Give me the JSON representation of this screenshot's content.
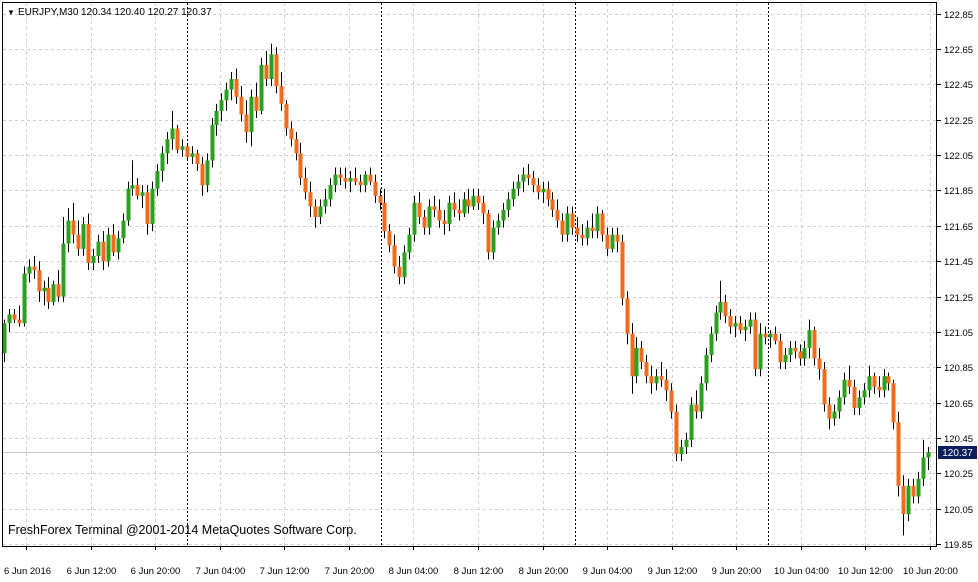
{
  "header": {
    "symbol": "EURJPY,M30",
    "ohlc": "120.34 120.40 120.27 120.37",
    "arrow": "▼"
  },
  "watermark": "FreshForex Terminal @2001-2014 MetaQuotes Software Corp.",
  "current_price_label": "120.37",
  "colors": {
    "bull": "#2aa01e",
    "bear": "#f26b1d",
    "wick": "#000000",
    "grid": "#cfcfcf",
    "separator": "#000000",
    "price_tag_bg": "#0b1f5c",
    "price_tag_fg": "#ffffff"
  },
  "chart_data": {
    "type": "candlestick",
    "timeframe": "M30",
    "grid": true,
    "y_ticks": [
      "122.85",
      "122.65",
      "122.45",
      "122.25",
      "122.05",
      "121.85",
      "121.65",
      "121.45",
      "121.25",
      "121.05",
      "120.85",
      "120.65",
      "120.45",
      "120.25",
      "120.05",
      "119.85"
    ],
    "x_ticks": [
      "6 Jun 2016",
      "6 Jun 12:00",
      "6 Jun 20:00",
      "7 Jun 04:00",
      "7 Jun 12:00",
      "7 Jun 20:00",
      "8 Jun 04:00",
      "8 Jun 12:00",
      "8 Jun 20:00",
      "9 Jun 04:00",
      "9 Jun 12:00",
      "9 Jun 20:00",
      "10 Jun 04:00",
      "10 Jun 12:00",
      "10 Jun 20:00"
    ],
    "day_separators_after": [
      "6 Jun 20:00",
      "7 Jun 20:00",
      "8 Jun 20:00",
      "9 Jun 20:00"
    ],
    "y_range": [
      119.84,
      122.91
    ],
    "last_close": 120.37,
    "ohlc": [
      [
        120.93,
        121.12,
        120.88,
        121.1
      ],
      [
        121.1,
        121.18,
        121.05,
        121.15
      ],
      [
        121.15,
        121.18,
        121.1,
        121.12
      ],
      [
        121.12,
        121.2,
        121.08,
        121.1
      ],
      [
        121.1,
        121.42,
        121.08,
        121.38
      ],
      [
        121.38,
        121.46,
        121.33,
        121.42
      ],
      [
        121.42,
        121.48,
        121.35,
        121.4
      ],
      [
        121.4,
        121.45,
        121.22,
        121.28
      ],
      [
        121.28,
        121.34,
        121.2,
        121.3
      ],
      [
        121.3,
        121.36,
        121.18,
        121.22
      ],
      [
        121.22,
        121.34,
        121.2,
        121.32
      ],
      [
        121.32,
        121.4,
        121.22,
        121.25
      ],
      [
        121.25,
        121.7,
        121.22,
        121.55
      ],
      [
        121.55,
        121.75,
        121.5,
        121.68
      ],
      [
        121.68,
        121.78,
        121.55,
        121.6
      ],
      [
        121.6,
        121.68,
        121.48,
        121.52
      ],
      [
        121.52,
        121.7,
        121.48,
        121.66
      ],
      [
        121.66,
        121.72,
        121.4,
        121.44
      ],
      [
        121.44,
        121.52,
        121.4,
        121.48
      ],
      [
        121.48,
        121.6,
        121.44,
        121.56
      ],
      [
        121.56,
        121.62,
        121.4,
        121.45
      ],
      [
        121.45,
        121.64,
        121.42,
        121.6
      ],
      [
        121.6,
        121.66,
        121.48,
        121.5
      ],
      [
        121.5,
        121.62,
        121.46,
        121.58
      ],
      [
        121.58,
        121.72,
        121.55,
        121.68
      ],
      [
        121.68,
        121.9,
        121.65,
        121.86
      ],
      [
        121.86,
        122.02,
        121.82,
        121.88
      ],
      [
        121.88,
        121.92,
        121.8,
        121.82
      ],
      [
        121.82,
        121.88,
        121.75,
        121.84
      ],
      [
        121.84,
        121.88,
        121.6,
        121.66
      ],
      [
        121.66,
        121.9,
        121.62,
        121.86
      ],
      [
        121.86,
        122.0,
        121.82,
        121.96
      ],
      [
        121.96,
        122.1,
        121.9,
        122.06
      ],
      [
        122.06,
        122.18,
        122.0,
        122.14
      ],
      [
        122.14,
        122.3,
        122.08,
        122.2
      ],
      [
        122.2,
        122.22,
        122.06,
        122.08
      ],
      [
        122.08,
        122.14,
        122.04,
        122.1
      ],
      [
        122.1,
        122.12,
        122.02,
        122.04
      ],
      [
        122.04,
        122.1,
        122.0,
        122.06
      ],
      [
        122.06,
        122.08,
        121.96,
        122.0
      ],
      [
        122.0,
        122.04,
        121.82,
        121.88
      ],
      [
        121.88,
        122.06,
        121.84,
        122.02
      ],
      [
        122.02,
        122.26,
        121.98,
        122.22
      ],
      [
        122.22,
        122.34,
        122.16,
        122.3
      ],
      [
        122.3,
        122.4,
        122.24,
        122.36
      ],
      [
        122.36,
        122.46,
        122.3,
        122.42
      ],
      [
        122.42,
        122.52,
        122.36,
        122.48
      ],
      [
        122.48,
        122.54,
        122.34,
        122.38
      ],
      [
        122.38,
        122.44,
        122.24,
        122.28
      ],
      [
        122.28,
        122.36,
        122.12,
        122.18
      ],
      [
        122.18,
        122.42,
        122.1,
        122.38
      ],
      [
        122.38,
        122.46,
        122.26,
        122.3
      ],
      [
        122.3,
        122.6,
        122.28,
        122.56
      ],
      [
        122.56,
        122.64,
        122.44,
        122.48
      ],
      [
        122.48,
        122.68,
        122.44,
        122.62
      ],
      [
        122.62,
        122.66,
        122.4,
        122.44
      ],
      [
        122.44,
        122.52,
        122.3,
        122.34
      ],
      [
        122.34,
        122.36,
        122.16,
        122.2
      ],
      [
        122.2,
        122.24,
        122.1,
        122.14
      ],
      [
        122.14,
        122.18,
        122.02,
        122.06
      ],
      [
        122.06,
        122.12,
        121.88,
        121.92
      ],
      [
        121.92,
        121.98,
        121.8,
        121.84
      ],
      [
        121.84,
        121.9,
        121.7,
        121.76
      ],
      [
        121.76,
        121.8,
        121.64,
        121.7
      ],
      [
        121.7,
        121.8,
        121.66,
        121.76
      ],
      [
        121.76,
        121.86,
        121.72,
        121.8
      ],
      [
        121.8,
        121.92,
        121.76,
        121.88
      ],
      [
        121.88,
        121.98,
        121.84,
        121.94
      ],
      [
        121.94,
        121.98,
        121.88,
        121.92
      ],
      [
        121.92,
        121.98,
        121.86,
        121.9
      ],
      [
        121.9,
        121.96,
        121.84,
        121.92
      ],
      [
        121.92,
        121.98,
        121.88,
        121.9
      ],
      [
        121.9,
        121.94,
        121.84,
        121.88
      ],
      [
        121.88,
        121.96,
        121.84,
        121.94
      ],
      [
        121.94,
        121.98,
        121.88,
        121.9
      ],
      [
        121.9,
        121.94,
        121.78,
        121.82
      ],
      [
        121.82,
        121.86,
        121.74,
        121.78
      ],
      [
        121.78,
        121.86,
        121.58,
        121.62
      ],
      [
        121.62,
        121.66,
        121.5,
        121.54
      ],
      [
        121.54,
        121.6,
        121.38,
        121.42
      ],
      [
        121.42,
        121.48,
        121.32,
        121.36
      ],
      [
        121.36,
        121.54,
        121.32,
        121.5
      ],
      [
        121.5,
        121.64,
        121.46,
        121.6
      ],
      [
        121.6,
        121.82,
        121.56,
        121.78
      ],
      [
        121.78,
        121.84,
        121.66,
        121.7
      ],
      [
        121.7,
        121.74,
        121.6,
        121.64
      ],
      [
        121.64,
        121.8,
        121.6,
        121.76
      ],
      [
        121.76,
        121.82,
        121.7,
        121.74
      ],
      [
        121.74,
        121.8,
        121.64,
        121.68
      ],
      [
        121.68,
        121.74,
        121.6,
        121.66
      ],
      [
        121.66,
        121.82,
        121.62,
        121.78
      ],
      [
        121.78,
        121.84,
        121.7,
        121.74
      ],
      [
        121.74,
        121.8,
        121.68,
        121.72
      ],
      [
        121.72,
        121.84,
        121.7,
        121.8
      ],
      [
        121.8,
        121.86,
        121.72,
        121.76
      ],
      [
        121.76,
        121.86,
        121.74,
        121.82
      ],
      [
        121.82,
        121.86,
        121.74,
        121.78
      ],
      [
        121.78,
        121.82,
        121.66,
        121.72
      ],
      [
        121.72,
        121.74,
        121.46,
        121.5
      ],
      [
        121.5,
        121.68,
        121.46,
        121.64
      ],
      [
        121.64,
        121.72,
        121.6,
        121.68
      ],
      [
        121.68,
        121.78,
        121.64,
        121.74
      ],
      [
        121.74,
        121.84,
        121.7,
        121.8
      ],
      [
        121.8,
        121.9,
        121.76,
        121.86
      ],
      [
        121.86,
        121.94,
        121.82,
        121.9
      ],
      [
        121.9,
        121.98,
        121.84,
        121.94
      ],
      [
        121.94,
        122.0,
        121.88,
        121.92
      ],
      [
        121.92,
        121.96,
        121.84,
        121.88
      ],
      [
        121.88,
        121.92,
        121.8,
        121.84
      ],
      [
        121.84,
        121.9,
        121.78,
        121.86
      ],
      [
        121.86,
        121.9,
        121.76,
        121.8
      ],
      [
        121.8,
        121.84,
        121.7,
        121.74
      ],
      [
        121.74,
        121.8,
        121.64,
        121.68
      ],
      [
        121.68,
        121.72,
        121.56,
        121.6
      ],
      [
        121.6,
        121.76,
        121.56,
        121.72
      ],
      [
        121.72,
        121.76,
        121.6,
        121.64
      ],
      [
        121.64,
        121.7,
        121.56,
        121.6
      ],
      [
        121.6,
        121.66,
        121.54,
        121.58
      ],
      [
        121.58,
        121.68,
        121.54,
        121.64
      ],
      [
        121.64,
        121.72,
        121.58,
        121.62
      ],
      [
        121.62,
        121.76,
        121.58,
        121.72
      ],
      [
        121.72,
        121.74,
        121.56,
        121.6
      ],
      [
        121.6,
        121.64,
        121.48,
        121.52
      ],
      [
        121.52,
        121.64,
        121.5,
        121.6
      ],
      [
        121.6,
        121.64,
        121.5,
        121.56
      ],
      [
        121.56,
        121.6,
        121.2,
        121.24
      ],
      [
        121.24,
        121.28,
        120.98,
        121.04
      ],
      [
        121.04,
        121.1,
        120.7,
        120.8
      ],
      [
        120.8,
        121.02,
        120.76,
        120.96
      ],
      [
        120.96,
        121.0,
        120.84,
        120.88
      ],
      [
        120.88,
        120.92,
        120.76,
        120.8
      ],
      [
        120.8,
        120.86,
        120.7,
        120.76
      ],
      [
        120.76,
        120.84,
        120.72,
        120.8
      ],
      [
        120.8,
        120.88,
        120.74,
        120.78
      ],
      [
        120.78,
        120.84,
        120.66,
        120.72
      ],
      [
        120.72,
        120.76,
        120.56,
        120.6
      ],
      [
        120.6,
        120.64,
        120.32,
        120.36
      ],
      [
        120.36,
        120.44,
        120.32,
        120.4
      ],
      [
        120.4,
        120.48,
        120.36,
        120.44
      ],
      [
        120.44,
        120.68,
        120.4,
        120.64
      ],
      [
        120.64,
        120.72,
        120.56,
        120.6
      ],
      [
        120.6,
        120.8,
        120.56,
        120.76
      ],
      [
        120.76,
        120.96,
        120.72,
        120.92
      ],
      [
        120.92,
        121.08,
        120.88,
        121.04
      ],
      [
        121.04,
        121.2,
        121.0,
        121.16
      ],
      [
        121.16,
        121.34,
        121.12,
        121.22
      ],
      [
        121.22,
        121.26,
        121.1,
        121.14
      ],
      [
        121.14,
        121.18,
        121.04,
        121.08
      ],
      [
        121.08,
        121.14,
        121.02,
        121.1
      ],
      [
        121.1,
        121.14,
        121.04,
        121.06
      ],
      [
        121.06,
        121.12,
        121.0,
        121.08
      ],
      [
        121.08,
        121.16,
        121.04,
        121.12
      ],
      [
        121.12,
        121.16,
        120.8,
        120.84
      ],
      [
        120.84,
        121.1,
        120.8,
        121.04
      ],
      [
        121.04,
        121.08,
        120.98,
        121.02
      ],
      [
        121.02,
        121.06,
        120.96,
        121.04
      ],
      [
        121.04,
        121.08,
        120.98,
        121.0
      ],
      [
        121.0,
        121.04,
        120.84,
        120.88
      ],
      [
        120.88,
        120.96,
        120.84,
        120.92
      ],
      [
        120.92,
        121.0,
        120.88,
        120.96
      ],
      [
        120.96,
        121.0,
        120.9,
        120.94
      ],
      [
        120.94,
        120.98,
        120.86,
        120.9
      ],
      [
        120.9,
        121.0,
        120.86,
        120.96
      ],
      [
        120.96,
        121.12,
        120.9,
        121.06
      ],
      [
        121.06,
        121.08,
        120.86,
        120.9
      ],
      [
        120.9,
        120.96,
        120.78,
        120.84
      ],
      [
        120.84,
        120.88,
        120.6,
        120.64
      ],
      [
        120.64,
        120.68,
        120.5,
        120.56
      ],
      [
        120.56,
        120.64,
        120.52,
        120.6
      ],
      [
        120.6,
        120.72,
        120.56,
        120.68
      ],
      [
        120.68,
        120.82,
        120.64,
        120.78
      ],
      [
        120.78,
        120.86,
        120.7,
        120.74
      ],
      [
        120.74,
        120.78,
        120.58,
        120.62
      ],
      [
        120.62,
        120.72,
        120.58,
        120.68
      ],
      [
        120.68,
        120.76,
        120.64,
        120.72
      ],
      [
        120.72,
        120.86,
        120.68,
        120.8
      ],
      [
        120.8,
        120.82,
        120.7,
        120.74
      ],
      [
        120.74,
        120.8,
        120.68,
        120.72
      ],
      [
        120.72,
        120.84,
        120.68,
        120.8
      ],
      [
        120.8,
        120.82,
        120.72,
        120.76
      ],
      [
        120.76,
        120.78,
        120.5,
        120.54
      ],
      [
        120.54,
        120.6,
        120.12,
        120.18
      ],
      [
        120.18,
        120.24,
        119.9,
        120.02
      ],
      [
        120.02,
        120.22,
        119.98,
        120.18
      ],
      [
        120.18,
        120.22,
        120.08,
        120.12
      ],
      [
        120.12,
        120.26,
        120.08,
        120.22
      ],
      [
        120.22,
        120.44,
        120.18,
        120.34
      ],
      [
        120.34,
        120.4,
        120.27,
        120.37
      ]
    ]
  }
}
